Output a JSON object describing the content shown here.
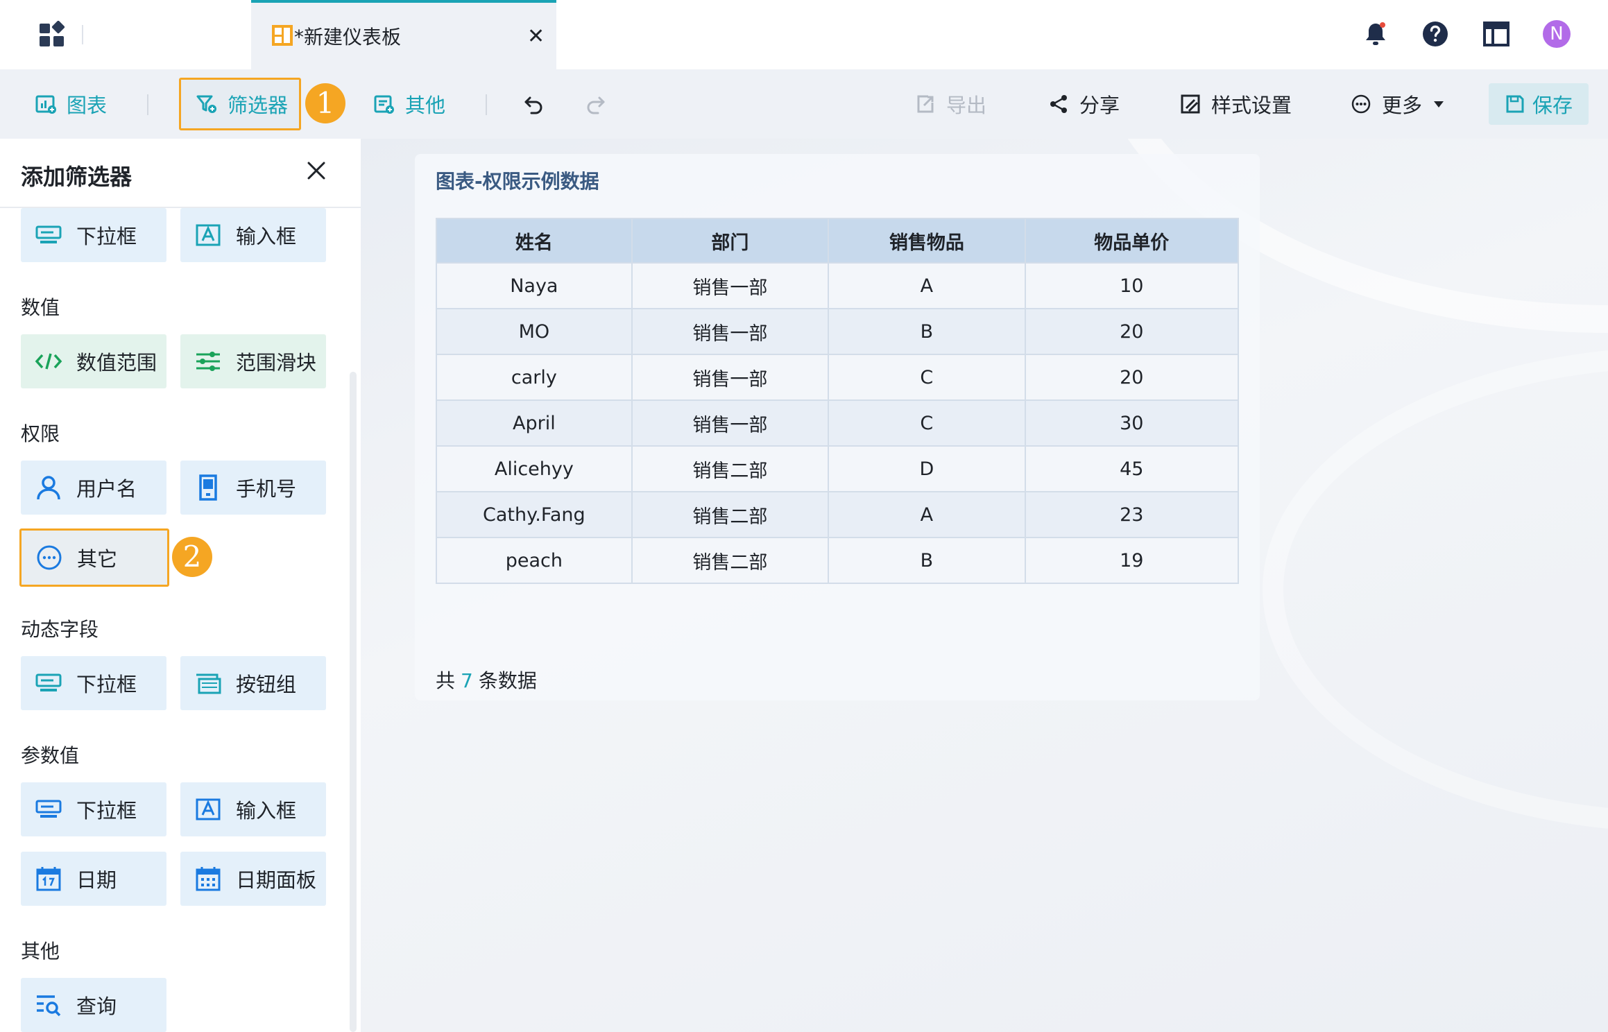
{
  "tab": {
    "title": "*新建仪表板",
    "close_symbol": "✕"
  },
  "user": {
    "avatar_letter": "N"
  },
  "toolbar": {
    "chart_label": "图表",
    "filter_label": "筛选器",
    "other_label": "其他",
    "export_label": "导出",
    "share_label": "分享",
    "style_label": "样式设置",
    "more_label": "更多",
    "save_label": "保存"
  },
  "badges": {
    "first": "1",
    "second": "2"
  },
  "panel": {
    "title": "添加筛选器",
    "sections": {
      "numeric": "数值",
      "permission": "权限",
      "dynamic": "动态字段",
      "param": "参数值",
      "other": "其他"
    },
    "chips": {
      "top_dropdown": "下拉框",
      "top_input": "输入框",
      "num_range": "数值范围",
      "range_slider": "范围滑块",
      "username": "用户名",
      "phone": "手机号",
      "other_perm": "其它",
      "dyn_dropdown": "下拉框",
      "dyn_btngroup": "按钮组",
      "param_dropdown": "下拉框",
      "param_input": "输入框",
      "param_date": "日期",
      "param_datepanel": "日期面板",
      "query": "查询"
    }
  },
  "card": {
    "title": "图表-权限示例数据",
    "columns": [
      "姓名",
      "部门",
      "销售物品",
      "物品单价"
    ],
    "rows": [
      [
        "Naya",
        "销售一部",
        "A",
        "10"
      ],
      [
        "MO",
        "销售一部",
        "B",
        "20"
      ],
      [
        "carly",
        "销售一部",
        "C",
        "20"
      ],
      [
        "April",
        "销售一部",
        "C",
        "30"
      ],
      [
        "Alicehyy",
        "销售二部",
        "D",
        "45"
      ],
      [
        "Cathy.Fang",
        "销售二部",
        "A",
        "23"
      ],
      [
        "peach",
        "销售二部",
        "B",
        "19"
      ]
    ],
    "footer_prefix": "共",
    "footer_count": "7",
    "footer_suffix": "条数据"
  },
  "colors": {
    "accent": "#1aa3b5",
    "highlight": "#f5a623",
    "avatar": "#b26be8"
  }
}
